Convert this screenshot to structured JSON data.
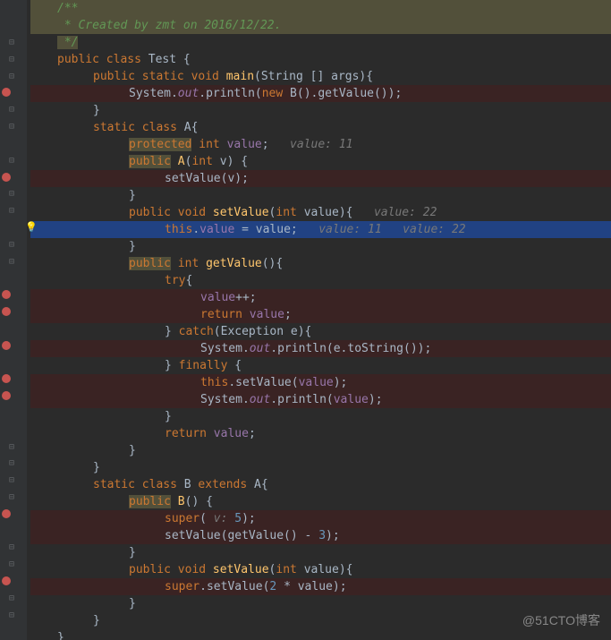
{
  "comment": {
    "l1": "/**",
    "l2": " * Created by zmt on 2016/12/22.",
    "l3": " */"
  },
  "code": {
    "l4_pre": "public class ",
    "l4_cls": "Test",
    "l4_post": " {",
    "l5_pre": "public static void ",
    "l5_m": "main",
    "l5_post": "(String [] args){",
    "l6_a": "System.",
    "l6_b": "out",
    "l6_c": ".println(",
    "l6_d": "new ",
    "l6_e": "B().getValue());",
    "l7": "}",
    "l8_pre": "static class ",
    "l8_cls": "A",
    "l8_post": "{",
    "l9_a": "protected",
    "l9_b": " int ",
    "l9_c": "value",
    "l9_d": ";   ",
    "l9_inlay": "value: 11",
    "l10_a": "public",
    "l10_b": " ",
    "l10_c": "A",
    "l10_d": "(",
    "l10_e": "int ",
    "l10_f": "v) {",
    "l11_a": "setValue(",
    "l11_b": "v",
    "l11_c": ");",
    "l12": "}",
    "l13_a": "public void ",
    "l13_b": "setValue",
    "l13_c": "(",
    "l13_d": "int ",
    "l13_e": "value){   ",
    "l13_inlay": "value: 22",
    "l14_a": "this",
    "l14_b": ".",
    "l14_c": "value",
    "l14_d": " = ",
    "l14_e": "value",
    "l14_f": ";   ",
    "l14_inlay1": "value: 11",
    "l14_gap": "   ",
    "l14_inlay2": "value: 22",
    "l15": "}",
    "l16_a": "public",
    "l16_b": " int ",
    "l16_c": "getValue",
    "l16_d": "(){",
    "l17_a": "try",
    "l17_b": "{",
    "l18_a": "value",
    "l18_b": "++;",
    "l19_a": "return ",
    "l19_b": "value",
    "l19_c": ";",
    "l20_a": "} ",
    "l20_b": "catch",
    "l20_c": "(Exception e){",
    "l21_a": "System.",
    "l21_b": "out",
    "l21_c": ".println(e.toString());",
    "l22_a": "} ",
    "l22_b": "finally ",
    "l22_c": "{",
    "l23_a": "this",
    "l23_b": ".setValue(",
    "l23_c": "value",
    "l23_d": ");",
    "l24_a": "System.",
    "l24_b": "out",
    "l24_c": ".println(",
    "l24_d": "value",
    "l24_e": ");",
    "l25": "}",
    "l26_a": "return ",
    "l26_b": "value",
    "l26_c": ";",
    "l27": "}",
    "l28": "}",
    "l29_a": "static class ",
    "l29_b": "B",
    "l29_c": " extends ",
    "l29_d": "A",
    "l29_e": "{",
    "l30_a": "public",
    "l30_b": " ",
    "l30_c": "B",
    "l30_d": "() {",
    "l31_a": "super",
    "l31_b": "( ",
    "l31_inlay": "v: ",
    "l31_c": "5",
    "l31_d": ");",
    "l32_a": "setValue(getValue() - ",
    "l32_b": "3",
    "l32_c": ");",
    "l33": "}",
    "l34_a": "public void ",
    "l34_b": "setValue",
    "l34_c": "(",
    "l34_d": "int ",
    "l34_e": "value){",
    "l35_a": "super",
    "l35_b": ".setValue(",
    "l35_c": "2",
    "l35_d": " * ",
    "l35_e": "value",
    "l35_f": ");",
    "l36": "}",
    "l37": "}",
    "l38": "}"
  },
  "watermark": "@51CTO博客"
}
